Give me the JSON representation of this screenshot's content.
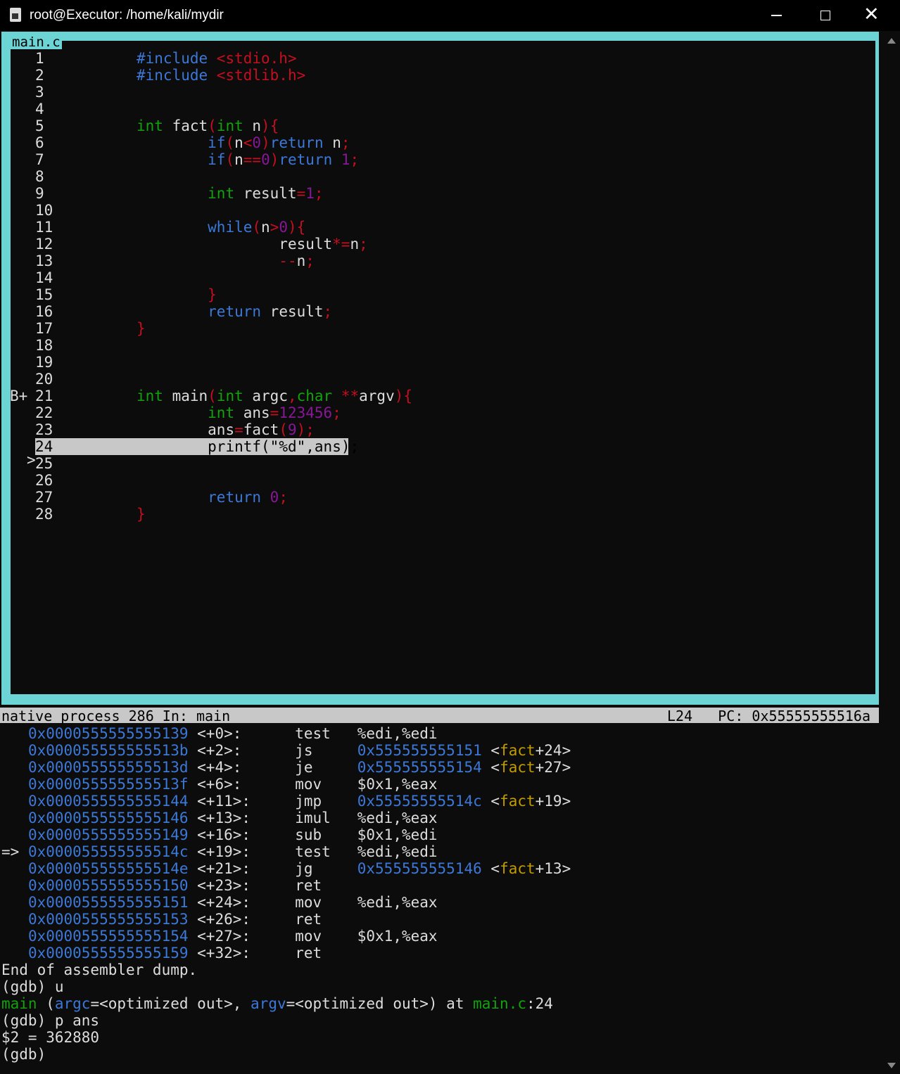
{
  "window": {
    "title": "root@Executor: /home/kali/mydir",
    "controls": {
      "minimize": "minimize-icon",
      "maximize": "maximize-icon",
      "close": "close-icon"
    }
  },
  "source_pane": {
    "label": "main.c",
    "border_color": "#6cd4d4",
    "current_line": 24,
    "breakpoint_line": 21,
    "lines": [
      {
        "n": "1",
        "marker": "",
        "tokens": [
          [
            "pp",
            "#include "
          ],
          [
            "st",
            "<stdio.h>"
          ]
        ]
      },
      {
        "n": "2",
        "marker": "",
        "tokens": [
          [
            "pp",
            "#include "
          ],
          [
            "st",
            "<stdlib.h>"
          ]
        ]
      },
      {
        "n": "3",
        "marker": "",
        "tokens": []
      },
      {
        "n": "4",
        "marker": "",
        "tokens": []
      },
      {
        "n": "5",
        "marker": "",
        "tokens": [
          [
            "ty",
            "int "
          ],
          [
            "id",
            "fact"
          ],
          [
            "pu",
            "("
          ],
          [
            "ty",
            "int "
          ],
          [
            "id",
            "n"
          ],
          [
            "pu",
            "){"
          ]
        ]
      },
      {
        "n": "6",
        "marker": "",
        "tokens": [
          [
            "id",
            "        "
          ],
          [
            "kw",
            "if"
          ],
          [
            "pu",
            "("
          ],
          [
            "id",
            "n"
          ],
          [
            "op",
            "<"
          ],
          [
            "nm",
            "0"
          ],
          [
            "pu",
            ")"
          ],
          [
            "kw",
            "return "
          ],
          [
            "id",
            "n"
          ],
          [
            "pu",
            ";"
          ]
        ]
      },
      {
        "n": "7",
        "marker": "",
        "tokens": [
          [
            "id",
            "        "
          ],
          [
            "kw",
            "if"
          ],
          [
            "pu",
            "("
          ],
          [
            "id",
            "n"
          ],
          [
            "op",
            "=="
          ],
          [
            "nm",
            "0"
          ],
          [
            "pu",
            ")"
          ],
          [
            "kw",
            "return "
          ],
          [
            "nm",
            "1"
          ],
          [
            "pu",
            ";"
          ]
        ]
      },
      {
        "n": "8",
        "marker": "",
        "tokens": []
      },
      {
        "n": "9",
        "marker": "",
        "tokens": [
          [
            "id",
            "        "
          ],
          [
            "ty",
            "int "
          ],
          [
            "id",
            "result"
          ],
          [
            "op",
            "="
          ],
          [
            "nm",
            "1"
          ],
          [
            "pu",
            ";"
          ]
        ]
      },
      {
        "n": "10",
        "marker": "",
        "tokens": []
      },
      {
        "n": "11",
        "marker": "",
        "tokens": [
          [
            "id",
            "        "
          ],
          [
            "kw",
            "while"
          ],
          [
            "pu",
            "("
          ],
          [
            "id",
            "n"
          ],
          [
            "op",
            ">"
          ],
          [
            "nm",
            "0"
          ],
          [
            "pu",
            "){"
          ]
        ]
      },
      {
        "n": "12",
        "marker": "",
        "tokens": [
          [
            "id",
            "                "
          ],
          [
            "id",
            "result"
          ],
          [
            "op",
            "*="
          ],
          [
            "id",
            "n"
          ],
          [
            "pu",
            ";"
          ]
        ]
      },
      {
        "n": "13",
        "marker": "",
        "tokens": [
          [
            "id",
            "                "
          ],
          [
            "op",
            "--"
          ],
          [
            "id",
            "n"
          ],
          [
            "pu",
            ";"
          ]
        ]
      },
      {
        "n": "14",
        "marker": "",
        "tokens": []
      },
      {
        "n": "15",
        "marker": "",
        "tokens": [
          [
            "id",
            "        "
          ],
          [
            "pu",
            "}"
          ]
        ]
      },
      {
        "n": "16",
        "marker": "",
        "tokens": [
          [
            "id",
            "        "
          ],
          [
            "kw",
            "return "
          ],
          [
            "id",
            "result"
          ],
          [
            "pu",
            ";"
          ]
        ]
      },
      {
        "n": "17",
        "marker": "",
        "tokens": [
          [
            "pu",
            "}"
          ]
        ]
      },
      {
        "n": "18",
        "marker": "",
        "tokens": []
      },
      {
        "n": "19",
        "marker": "",
        "tokens": []
      },
      {
        "n": "20",
        "marker": "",
        "tokens": []
      },
      {
        "n": "21",
        "marker": "B+",
        "tokens": [
          [
            "ty",
            "int "
          ],
          [
            "id",
            "main"
          ],
          [
            "pu",
            "("
          ],
          [
            "ty",
            "int "
          ],
          [
            "id",
            "argc"
          ],
          [
            "pu",
            ","
          ],
          [
            "ty",
            "char "
          ],
          [
            "op",
            "**"
          ],
          [
            "id",
            "argv"
          ],
          [
            "pu",
            "){"
          ]
        ]
      },
      {
        "n": "22",
        "marker": "",
        "tokens": [
          [
            "id",
            "        "
          ],
          [
            "ty",
            "int "
          ],
          [
            "id",
            "ans"
          ],
          [
            "op",
            "="
          ],
          [
            "nm",
            "123456"
          ],
          [
            "pu",
            ";"
          ]
        ]
      },
      {
        "n": "23",
        "marker": "",
        "tokens": [
          [
            "id",
            "        "
          ],
          [
            "id",
            "ans"
          ],
          [
            "op",
            "="
          ],
          [
            "id",
            "fact"
          ],
          [
            "pu",
            "("
          ],
          [
            "nm",
            "9"
          ],
          [
            "pu",
            ");"
          ]
        ]
      },
      {
        "n": "24",
        "marker": ">",
        "tokens": [
          [
            "id",
            "        "
          ],
          [
            "id",
            "printf"
          ],
          [
            "pu",
            "("
          ],
          [
            "st",
            "\"%d\""
          ],
          [
            "pu",
            ","
          ],
          [
            "id",
            "ans"
          ],
          [
            "pu",
            ");"
          ]
        ]
      },
      {
        "n": "25",
        "marker": "",
        "tokens": []
      },
      {
        "n": "26",
        "marker": "",
        "tokens": []
      },
      {
        "n": "27",
        "marker": "",
        "tokens": [
          [
            "id",
            "        "
          ],
          [
            "kw",
            "return "
          ],
          [
            "nm",
            "0"
          ],
          [
            "pu",
            ";"
          ]
        ]
      },
      {
        "n": "28",
        "marker": "",
        "tokens": [
          [
            "pu",
            "}"
          ]
        ]
      }
    ]
  },
  "status_bar": {
    "left": "native process 286 In: main",
    "line": "L24",
    "pc": "PC: 0x55555555516a"
  },
  "console": {
    "asm": [
      {
        "arrow": "",
        "addr": "0x0000555555555139",
        "off": "<+0>:",
        "op": "test",
        "args": [
          [
            "t",
            "%edi,%edi"
          ]
        ]
      },
      {
        "arrow": "",
        "addr": "0x000055555555513b",
        "off": "<+2>:",
        "op": "js",
        "args": [
          [
            "a",
            "0x555555555151"
          ],
          [
            "t",
            " <"
          ],
          [
            "s",
            "fact"
          ],
          [
            "t",
            "+24>"
          ]
        ]
      },
      {
        "arrow": "",
        "addr": "0x000055555555513d",
        "off": "<+4>:",
        "op": "je",
        "args": [
          [
            "a",
            "0x555555555154"
          ],
          [
            "t",
            " <"
          ],
          [
            "s",
            "fact"
          ],
          [
            "t",
            "+27>"
          ]
        ]
      },
      {
        "arrow": "",
        "addr": "0x000055555555513f",
        "off": "<+6>:",
        "op": "mov",
        "args": [
          [
            "t",
            "$0x1,%eax"
          ]
        ]
      },
      {
        "arrow": "",
        "addr": "0x0000555555555144",
        "off": "<+11>:",
        "op": "jmp",
        "args": [
          [
            "a",
            "0x55555555514c"
          ],
          [
            "t",
            " <"
          ],
          [
            "s",
            "fact"
          ],
          [
            "t",
            "+19>"
          ]
        ]
      },
      {
        "arrow": "",
        "addr": "0x0000555555555146",
        "off": "<+13>:",
        "op": "imul",
        "args": [
          [
            "t",
            "%edi,%eax"
          ]
        ]
      },
      {
        "arrow": "",
        "addr": "0x0000555555555149",
        "off": "<+16>:",
        "op": "sub",
        "args": [
          [
            "t",
            "$0x1,%edi"
          ]
        ]
      },
      {
        "arrow": "=>",
        "addr": "0x000055555555514c",
        "off": "<+19>:",
        "op": "test",
        "args": [
          [
            "t",
            "%edi,%edi"
          ]
        ]
      },
      {
        "arrow": "",
        "addr": "0x000055555555514e",
        "off": "<+21>:",
        "op": "jg",
        "args": [
          [
            "a",
            "0x555555555146"
          ],
          [
            "t",
            " <"
          ],
          [
            "s",
            "fact"
          ],
          [
            "t",
            "+13>"
          ]
        ]
      },
      {
        "arrow": "",
        "addr": "0x0000555555555150",
        "off": "<+23>:",
        "op": "ret",
        "args": []
      },
      {
        "arrow": "",
        "addr": "0x0000555555555151",
        "off": "<+24>:",
        "op": "mov",
        "args": [
          [
            "t",
            "%edi,%eax"
          ]
        ]
      },
      {
        "arrow": "",
        "addr": "0x0000555555555153",
        "off": "<+26>:",
        "op": "ret",
        "args": []
      },
      {
        "arrow": "",
        "addr": "0x0000555555555154",
        "off": "<+27>:",
        "op": "mov",
        "args": [
          [
            "t",
            "$0x1,%eax"
          ]
        ]
      },
      {
        "arrow": "",
        "addr": "0x0000555555555159",
        "off": "<+32>:",
        "op": "ret",
        "args": []
      }
    ],
    "tail": [
      [
        [
          "t",
          "End of assembler dump."
        ]
      ],
      [
        [
          "t",
          "(gdb) u"
        ]
      ],
      [
        [
          "g",
          "main"
        ],
        [
          "t",
          " ("
        ],
        [
          "b",
          "argc"
        ],
        [
          "t",
          "=<optimized out>, "
        ],
        [
          "b",
          "argv"
        ],
        [
          "t",
          "=<optimized out>) at "
        ],
        [
          "g",
          "main.c"
        ],
        [
          "t",
          ":24"
        ]
      ],
      [
        [
          "t",
          "(gdb) p ans"
        ]
      ],
      [
        [
          "t",
          "$2 = 362880"
        ]
      ],
      [
        [
          "t",
          "(gdb) "
        ]
      ]
    ]
  }
}
